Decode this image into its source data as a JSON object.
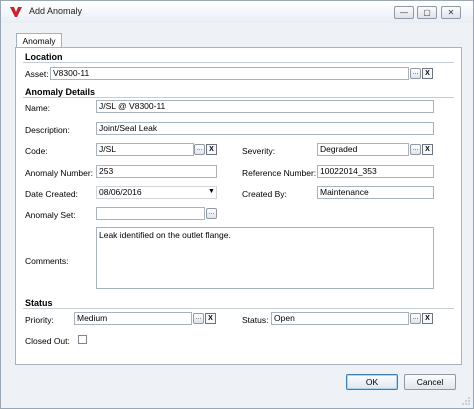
{
  "window": {
    "title": "Add Anomaly",
    "minimize": "—",
    "maximize": "▢",
    "close": "✕"
  },
  "tabs": [
    {
      "label": "Anomaly"
    }
  ],
  "location": {
    "heading": "Location",
    "asset_label": "Asset:",
    "asset_value": "V8300-11"
  },
  "details": {
    "heading": "Anomaly Details",
    "name_label": "Name:",
    "name_value": "J/SL @ V8300-11",
    "description_label": "Description:",
    "description_value": "Joint/Seal Leak",
    "code_label": "Code:",
    "code_value": "J/SL",
    "severity_label": "Severity:",
    "severity_value": "Degraded",
    "anomaly_number_label": "Anomaly Number:",
    "anomaly_number_value": "253",
    "reference_number_label": "Reference Number:",
    "reference_number_value": "10022014_353",
    "date_created_label": "Date Created:",
    "date_created_value": "08/06/2016",
    "created_by_label": "Created By:",
    "created_by_value": "Maintenance",
    "anomaly_set_label": "Anomaly Set:",
    "anomaly_set_value": "",
    "comments_label": "Comments:",
    "comments_value": "Leak identified on the outlet flange."
  },
  "status": {
    "heading": "Status",
    "priority_label": "Priority:",
    "priority_value": "Medium",
    "status_label": "Status:",
    "status_value": "Open",
    "closed_out_label": "Closed Out:",
    "closed_out_checked": false
  },
  "glyphs": {
    "ellipsis": "...",
    "clear": "X",
    "dropdown": "▼"
  },
  "buttons": {
    "ok": "OK",
    "cancel": "Cancel"
  }
}
